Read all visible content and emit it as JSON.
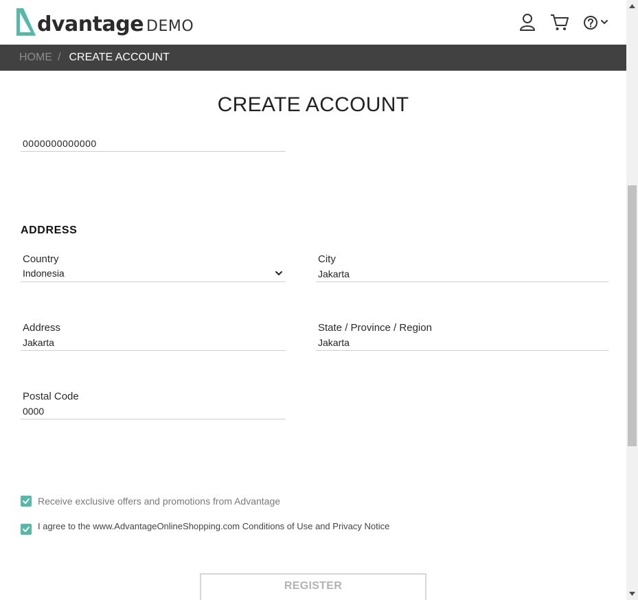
{
  "header": {
    "logo_word": "dvantage",
    "logo_demo": "DEMO",
    "brand_color": "#54b9a7",
    "icons": [
      "user-icon",
      "cart-icon",
      "help-icon"
    ]
  },
  "breadcrumb": {
    "home": "HOME",
    "separator": "/",
    "current": "CREATE ACCOUNT"
  },
  "page": {
    "title": "CREATE ACCOUNT",
    "phone_value": "0000000000000"
  },
  "address": {
    "section_title": "ADDRESS",
    "country": {
      "label": "Country",
      "value": "Indonesia"
    },
    "city": {
      "label": "City",
      "value": "Jakarta"
    },
    "address": {
      "label": "Address",
      "value": "Jakarta"
    },
    "state": {
      "label": "State / Province / Region",
      "value": "Jakarta"
    },
    "postal": {
      "label": "Postal Code",
      "value": "0000"
    }
  },
  "checks": {
    "offers": "Receive exclusive offers and promotions from Advantage",
    "agree": "I agree to the www.AdvantageOnlineShopping.com Conditions of Use and Privacy Notice"
  },
  "register_label": "REGISTER"
}
